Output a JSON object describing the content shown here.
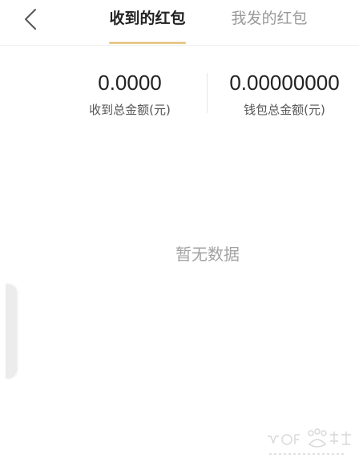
{
  "header": {
    "back_icon": "chevron-left-icon",
    "tabs": [
      {
        "label": "收到的红包",
        "active": true
      },
      {
        "label": "我发的红包",
        "active": false
      }
    ],
    "indicator_color": "#e8c88a"
  },
  "summary": {
    "received_total": {
      "amount": "0.0000",
      "label": "收到总金额(元)"
    },
    "wallet_total": {
      "amount": "0.00000000",
      "label": "钱包总金额(元)"
    }
  },
  "empty_state": {
    "text": "暂无数据"
  },
  "watermark": {
    "icon": "baidu-jingyan-logo"
  }
}
